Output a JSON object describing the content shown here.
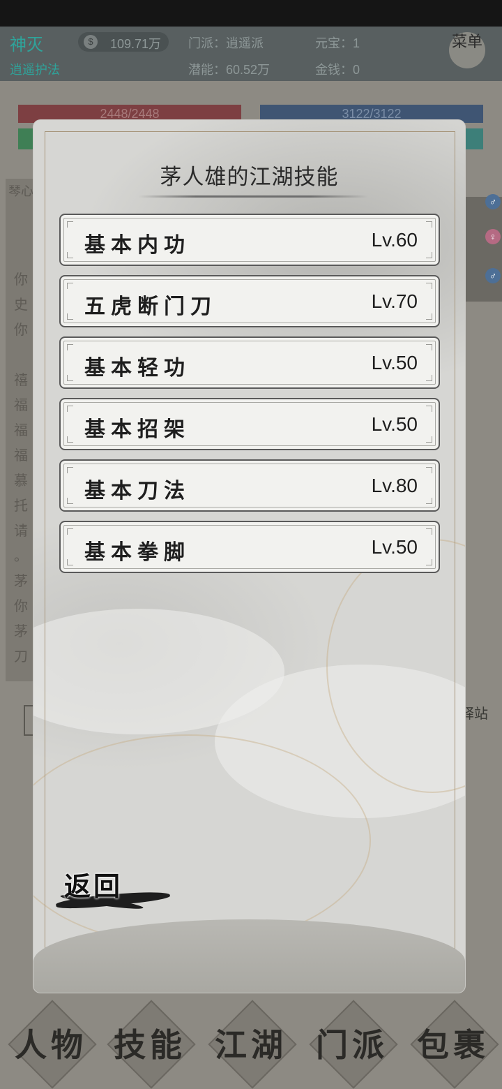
{
  "player": {
    "name": "神灭",
    "title": "逍遥护法",
    "currency_value": "109.71万",
    "sect": "门派：逍遥派",
    "yuanbao": "元宝：1",
    "potential": "潜能：60.52万",
    "money": "金钱：0",
    "menu_label": "菜单"
  },
  "bars": {
    "hp": "2448/2448",
    "mp": "3122/3122"
  },
  "chat": {
    "tab": "琴心",
    "lines": [
      "你",
      "史",
      "你",
      "禧",
      "福",
      "福",
      "福",
      "慕",
      "托",
      "请",
      "。",
      "茅",
      "你",
      "茅",
      "刀"
    ]
  },
  "station_label": "驿站",
  "nav": {
    "items": [
      "人物",
      "技能",
      "江湖",
      "门派",
      "包裹"
    ]
  },
  "modal": {
    "title": "茅人雄的江湖技能",
    "skills": [
      {
        "name": "基本内功",
        "level": "Lv.60"
      },
      {
        "name": "五虎断门刀",
        "level": "Lv.70"
      },
      {
        "name": "基本轻功",
        "level": "Lv.50"
      },
      {
        "name": "基本招架",
        "level": "Lv.50"
      },
      {
        "name": "基本刀法",
        "level": "Lv.80"
      },
      {
        "name": "基本拳脚",
        "level": "Lv.50"
      }
    ],
    "back_label": "返回"
  },
  "colors": {
    "accent_teal": "#2fa39a",
    "hp_red": "#7d3f42",
    "mp_blue": "#3f5573"
  }
}
